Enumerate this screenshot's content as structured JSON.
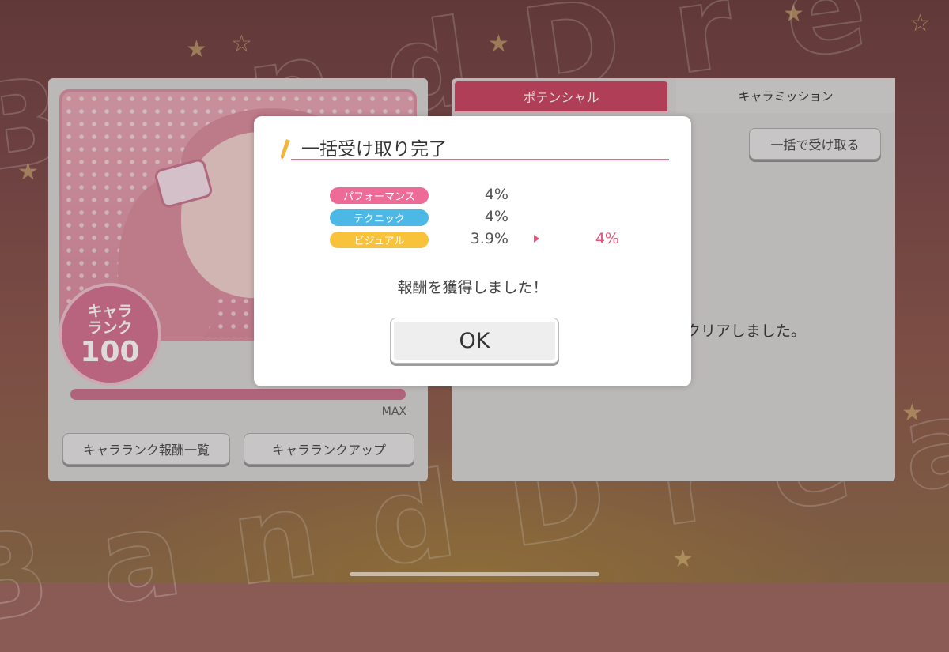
{
  "left_panel": {
    "rank_label": "キャラ\nランク",
    "rank_value": "100",
    "rank_progress": 1.0,
    "rank_max_label": "MAX",
    "rewards_list_button": "キャラランク報酬一覧",
    "rank_up_button": "キャラランクアップ"
  },
  "right_panel": {
    "tab_potential": "ポテンシャル",
    "tab_mission": "キャラミッション",
    "bulk_receive_button": "一括で受け取る",
    "mission_clear_text": "クリアしました。"
  },
  "modal": {
    "title": "一括受け取り完了",
    "stats": [
      {
        "label": "パフォーマンス",
        "value": "4%",
        "color": "#ee6b97"
      },
      {
        "label": "テクニック",
        "value": "4%",
        "color": "#4cb8e6"
      },
      {
        "label": "ビジュアル",
        "value": "3.9%",
        "new_value": "4%",
        "color": "#f8c23a"
      }
    ],
    "message": "報酬を獲得しました！",
    "ok_button": "OK"
  },
  "colors": {
    "accent_pink": "#e8527b",
    "tab_active": "#c9415f",
    "rank_badge": "#d36f8f"
  }
}
